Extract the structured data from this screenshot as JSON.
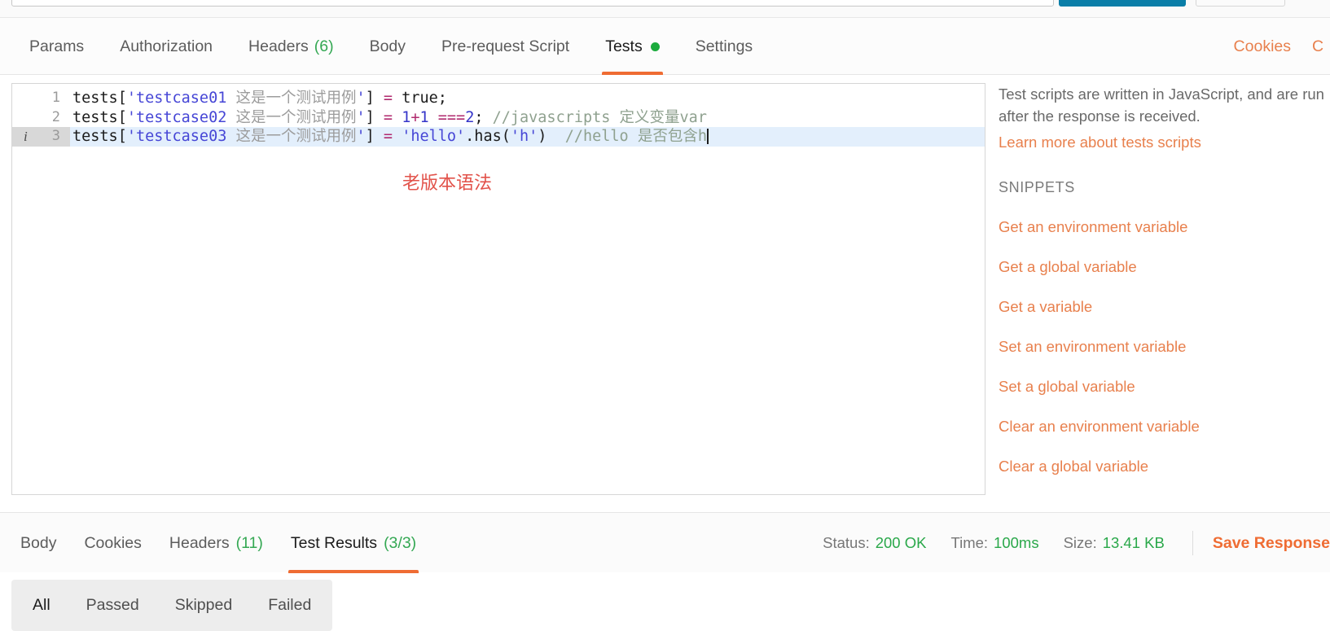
{
  "request_tabs": [
    {
      "label": "Params",
      "active": false,
      "count": "",
      "dot": false
    },
    {
      "label": "Authorization",
      "active": false,
      "count": "",
      "dot": false
    },
    {
      "label": "Headers",
      "active": false,
      "count": "(6)",
      "dot": false
    },
    {
      "label": "Body",
      "active": false,
      "count": "",
      "dot": false
    },
    {
      "label": "Pre-request Script",
      "active": false,
      "count": "",
      "dot": false
    },
    {
      "label": "Tests",
      "active": true,
      "count": "",
      "dot": true
    },
    {
      "label": "Settings",
      "active": false,
      "count": "",
      "dot": false
    }
  ],
  "cookies_link": "Cookies",
  "cookies_cut": "C",
  "editor": {
    "lines": [
      {
        "number": "1",
        "active": false,
        "info_icon": "",
        "tokens": [
          {
            "text": "tests[",
            "cls": "t-plain"
          },
          {
            "text": "'testcase01 ",
            "cls": "t-str"
          },
          {
            "text": "这是一个测试用例",
            "cls": "t-cjk"
          },
          {
            "text": "'",
            "cls": "t-str"
          },
          {
            "text": "] ",
            "cls": "t-plain"
          },
          {
            "text": "=",
            "cls": "t-op"
          },
          {
            "text": " true;",
            "cls": "t-kw"
          }
        ]
      },
      {
        "number": "2",
        "active": false,
        "info_icon": "",
        "tokens": [
          {
            "text": "tests[",
            "cls": "t-plain"
          },
          {
            "text": "'testcase02 ",
            "cls": "t-str"
          },
          {
            "text": "这是一个测试用例",
            "cls": "t-cjk"
          },
          {
            "text": "'",
            "cls": "t-str"
          },
          {
            "text": "] ",
            "cls": "t-plain"
          },
          {
            "text": "=",
            "cls": "t-op"
          },
          {
            "text": " 1",
            "cls": "t-num"
          },
          {
            "text": "+",
            "cls": "t-op"
          },
          {
            "text": "1 ",
            "cls": "t-num"
          },
          {
            "text": "===",
            "cls": "t-op"
          },
          {
            "text": "2",
            "cls": "t-num"
          },
          {
            "text": "; ",
            "cls": "t-plain"
          },
          {
            "text": "//javascripts 定义变量var",
            "cls": "t-comment"
          }
        ]
      },
      {
        "number": "3",
        "active": true,
        "info_icon": "i",
        "tokens": [
          {
            "text": "tests[",
            "cls": "t-plain"
          },
          {
            "text": "'testcase03 ",
            "cls": "t-str"
          },
          {
            "text": "这是一个测试用例",
            "cls": "t-cjk"
          },
          {
            "text": "'",
            "cls": "t-str"
          },
          {
            "text": "] ",
            "cls": "t-plain"
          },
          {
            "text": "=",
            "cls": "t-op"
          },
          {
            "text": " ",
            "cls": "t-plain"
          },
          {
            "text": "'hello'",
            "cls": "t-str"
          },
          {
            "text": ".has(",
            "cls": "t-plain"
          },
          {
            "text": "'h'",
            "cls": "t-str"
          },
          {
            "text": ")  ",
            "cls": "t-plain"
          },
          {
            "text": "//hello 是否包含h",
            "cls": "t-comment"
          }
        ]
      }
    ],
    "annotation": "老版本语法"
  },
  "help": {
    "description": "Test scripts are written in JavaScript, and are run after the response is received.",
    "learn_more": "Learn more about tests scripts",
    "snippets_title": "SNIPPETS",
    "snippets": [
      "Get an environment variable",
      "Get a global variable",
      "Get a variable",
      "Set an environment variable",
      "Set a global variable",
      "Clear an environment variable",
      "Clear a global variable"
    ]
  },
  "response": {
    "tabs": [
      {
        "label": "Body",
        "count": "",
        "active": false
      },
      {
        "label": "Cookies",
        "count": "",
        "active": false
      },
      {
        "label": "Headers",
        "count": "(11)",
        "active": false
      },
      {
        "label": "Test Results",
        "count": "(3/3)",
        "active": true
      }
    ],
    "status_label": "Status:",
    "status_value": "200 OK",
    "time_label": "Time:",
    "time_value": "100ms",
    "size_label": "Size:",
    "size_value": "13.41 KB",
    "save_response": "Save Response",
    "filters": [
      {
        "label": "All",
        "active": true
      },
      {
        "label": "Passed",
        "active": false
      },
      {
        "label": "Skipped",
        "active": false
      },
      {
        "label": "Failed",
        "active": false
      }
    ]
  },
  "colors": {
    "accent": "#ef6c33",
    "link": "#e8804d",
    "success": "#2aa84a",
    "count": "#34a853",
    "active_line": "#e3effc",
    "annotation": "#e2524a",
    "send_button": "#0a7ea8"
  }
}
